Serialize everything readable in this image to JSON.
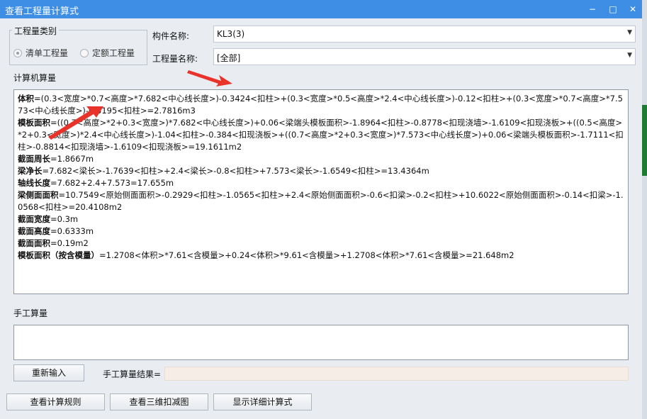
{
  "window": {
    "title": "查看工程量计算式",
    "minimize": "−",
    "maximize": "□",
    "close": "✕"
  },
  "quantity_type": {
    "group_label": "工程量类别",
    "option_list": "清单工程量",
    "option_quota": "定额工程量",
    "selected": "清单工程量"
  },
  "component": {
    "label": "构件名称:",
    "value": "KL3(3)"
  },
  "quantity_name": {
    "label": "工程量名称:",
    "value": "[全部]"
  },
  "computer": {
    "label": "计算机算量",
    "lines": [
      {
        "name": "体积",
        "formula": "=(0.3<宽度>*0.7<高度>*7.682<中心线长度>)-0.3424<扣柱>+(0.3<宽度>*0.5<高度>*2.4<中心线长度>)-0.12<扣柱>+(0.3<宽度>*0.7<高度>*7.573<中心线长度>)-0.3195<扣柱>=2.7816m3"
      },
      {
        "name": "模板面积",
        "formula": "=((0.7<高度>*2+0.3<宽度>)*7.682<中心线长度>)+0.06<梁端头模板面积>-1.8964<扣柱>-0.8778<扣现浇墙>-1.6109<扣现浇板>+((0.5<高度>*2+0.3<宽度>)*2.4<中心线长度>)-1.04<扣柱>-0.384<扣现浇板>+((0.7<高度>*2+0.3<宽度>)*7.573<中心线长度>)+0.06<梁端头模板面积>-1.7111<扣柱>-0.8814<扣现浇墙>-1.6109<扣现浇板>=19.1611m2"
      },
      {
        "name": "截面周长",
        "formula": "=1.8667m"
      },
      {
        "name": "梁净长",
        "formula": "=7.682<梁长>-1.7639<扣柱>+2.4<梁长>-0.8<扣柱>+7.573<梁长>-1.6549<扣柱>=13.4364m"
      },
      {
        "name": "轴线长度",
        "formula": "=7.682+2.4+7.573=17.655m"
      },
      {
        "name": "梁侧面面积",
        "formula": "=10.7549<原始侧面面积>-0.2929<扣柱>-1.0565<扣柱>+2.4<原始侧面面积>-0.6<扣梁>-0.2<扣柱>+10.6022<原始侧面面积>-0.14<扣梁>-1.0568<扣柱>=20.4108m2"
      },
      {
        "name": "截面宽度",
        "formula": "=0.3m"
      },
      {
        "name": "截面高度",
        "formula": "=0.6333m"
      },
      {
        "name": "截面面积",
        "formula": "=0.19m2"
      },
      {
        "name": "模板面积（按含模量）",
        "formula": "=1.2708<体积>*7.61<含模量>+0.24<体积>*9.61<含模量>+1.2708<体积>*7.61<含模量>=21.648m2"
      }
    ]
  },
  "manual": {
    "label": "手工算量",
    "value": "",
    "reenter_button": "重新输入",
    "result_label": "手工算量结果=",
    "result_value": ""
  },
  "buttons": {
    "view_rules": "查看计算规则",
    "view_3d": "查看三维扣减图",
    "show_detail": "显示详细计算式"
  },
  "colors": {
    "titlebar": "#3d8ee4",
    "annotation_arrow": "#e8322a",
    "result_field": "#f6ede6"
  }
}
